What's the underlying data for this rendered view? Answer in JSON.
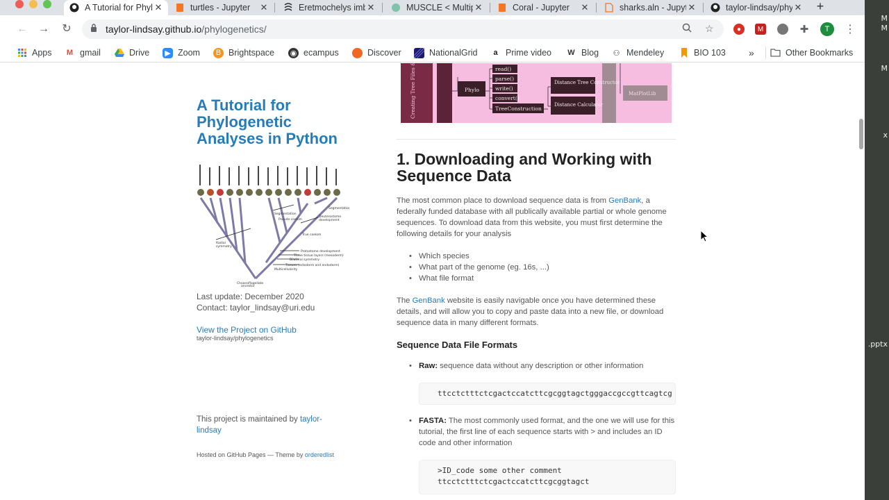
{
  "browser": {
    "tabs": [
      {
        "title": "A Tutorial for Phylogenetic Analyses in Python",
        "icon": "github-icon",
        "active": true
      },
      {
        "title": "turtles - Jupyter",
        "icon": "notebook-icon"
      },
      {
        "title": "Eretmochelys imbricata",
        "icon": "ncbi-icon"
      },
      {
        "title": "MUSCLE < Multiple Sequence Alignment",
        "icon": "ebi-icon"
      },
      {
        "title": "Coral - Jupyter",
        "icon": "notebook-icon"
      },
      {
        "title": "sharks.aln - Jupyter",
        "icon": "file-icon"
      },
      {
        "title": "taylor-lindsay/phylogenetics",
        "icon": "github-icon"
      }
    ],
    "new_tab": "+",
    "url_host": "taylor-lindsay.github.io",
    "url_path": "/phylogenetics/",
    "profile_initial": "T"
  },
  "bookmarks": [
    {
      "label": "Apps",
      "icon": "apps-icon",
      "color": "#4285f4"
    },
    {
      "label": "gmail",
      "icon": "gmail-icon",
      "color": "#ea4335"
    },
    {
      "label": "Drive",
      "icon": "drive-icon",
      "color": "#fbbc04"
    },
    {
      "label": "Zoom",
      "icon": "zoom-icon",
      "color": "#2d8cff"
    },
    {
      "label": "Brightspace",
      "icon": "brightspace-icon",
      "color": "#f7931e"
    },
    {
      "label": "ecampus",
      "icon": "ecampus-icon",
      "color": "#333333"
    },
    {
      "label": "Discover",
      "icon": "discover-icon",
      "color": "#f26522"
    },
    {
      "label": "NationalGrid",
      "icon": "nationalgrid-icon",
      "color": "#1b1b6e"
    },
    {
      "label": "Prime video",
      "icon": "amazon-icon",
      "color": "#222222"
    },
    {
      "label": "Blog",
      "icon": "wordpress-icon",
      "color": "#333333"
    },
    {
      "label": "Mendeley",
      "icon": "mendeley-icon",
      "color": "#333333"
    },
    {
      "label": "BIO 103",
      "icon": "bookmark-icon",
      "color": "#f29900"
    }
  ],
  "bookmarks_overflow": "»",
  "other_bookmarks": "Other Bookmarks",
  "sidebar": {
    "title": "A Tutorial for Phylogenetic Analyses in Python",
    "last_update": "Last update: December 2020",
    "contact": "Contact: taylor_lindsay@uri.edu",
    "github_link": "View the Project on GitHub",
    "github_repo": "taylor-lindsay/phylogenetics",
    "maintained_prefix": "This project is maintained by ",
    "maintainer": "taylor-lindsay",
    "hosted_prefix": "Hosted on GitHub Pages — Theme by ",
    "theme_author": "orderedlist"
  },
  "diagram": {
    "side_label": "Creating Tree Files & Figures",
    "phylo": "Phylo",
    "methods": [
      "read()",
      "parse()",
      "write()",
      "convert()",
      "TreeConstruction"
    ],
    "boxes": [
      "Distance Tree Constructor",
      "Distance Calculator"
    ],
    "matplotlib": "MatPlotLib"
  },
  "main": {
    "heading": "1. Downloading and Working with Sequence Data",
    "intro_before": "The most common place to download sequence data is from ",
    "intro_link": "GenBank",
    "intro_after": ", a federally funded database with all publically available partial or whole genome sequences. To download data from this website, you must first determine the following details for your analysis",
    "details": [
      "Which species",
      "What part of the genome (eg. 16s, ...)",
      "What file format"
    ],
    "p2_before": "The ",
    "p2_link": "GenBank",
    "p2_after": " website is easily navigable once you have determined these details, and will allow you to copy and paste data into a new file, or download sequence data in many different formats.",
    "formats_heading": "Sequence Data File Formats",
    "raw_label": "Raw:",
    "raw_desc": " sequence data without any description or other information",
    "raw_code": "ttcctctttctcgactccatcttcgcggtagctgggaccgccgttcagtcg",
    "fasta_label": "FASTA:",
    "fasta_desc": " The most commonly used format, and the one we will use for this tutorial, the first line of each sequence starts with > and includes an ID code and other information",
    "fasta_code_1": ">ID_code some other comment",
    "fasta_code_2": "ttcctctttctcgactccatcttcgcggtagct"
  },
  "desktop_labels": [
    "M",
    "M",
    "M",
    ".pptx",
    "x"
  ]
}
